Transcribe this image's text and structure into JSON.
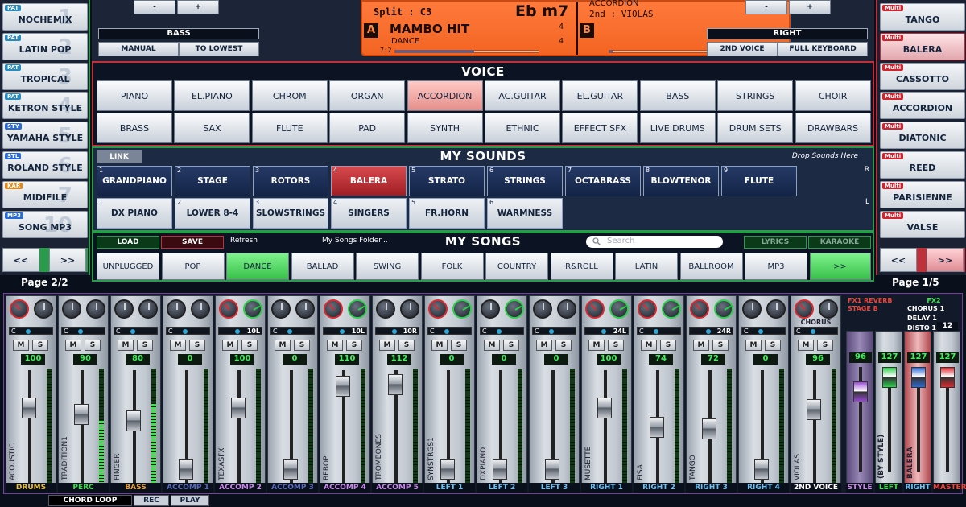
{
  "left_styles": [
    {
      "tag": "PAT",
      "tag_color": "teal",
      "label": "NOCHEMIX",
      "ghost": "1"
    },
    {
      "tag": "PAT",
      "tag_color": "teal",
      "label": "LATIN POP",
      "ghost": "2"
    },
    {
      "tag": "PAT",
      "tag_color": "teal",
      "label": "TROPICAL",
      "ghost": "3"
    },
    {
      "tag": "PAT",
      "tag_color": "teal",
      "label": "KETRON STYLE",
      "ghost": "4"
    },
    {
      "tag": "STY",
      "tag_color": "blue",
      "label": "YAMAHA STYLE",
      "ghost": "5"
    },
    {
      "tag": "STL",
      "tag_color": "blue",
      "label": "ROLAND STYLE",
      "ghost": "6"
    },
    {
      "tag": "KAR",
      "tag_color": "orange",
      "label": "MIDIFILE",
      "ghost": "7"
    },
    {
      "tag": "MP3",
      "tag_color": "blue",
      "label": "SONG MP3",
      "ghost": "10"
    }
  ],
  "right_styles": [
    {
      "tag": "Multi",
      "tag_color": "red",
      "label": "TANGO",
      "ghost": "",
      "selected": false
    },
    {
      "tag": "Multi",
      "tag_color": "red",
      "label": "BALERA",
      "ghost": "",
      "selected": true
    },
    {
      "tag": "Multi",
      "tag_color": "red",
      "label": "CASSOTTO",
      "ghost": "",
      "selected": false
    },
    {
      "tag": "Multi",
      "tag_color": "red",
      "label": "ACCORDION",
      "ghost": "",
      "selected": false
    },
    {
      "tag": "Multi",
      "tag_color": "red",
      "label": "DIATONIC",
      "ghost": "",
      "selected": false
    },
    {
      "tag": "Multi",
      "tag_color": "red",
      "label": "REED",
      "ghost": "",
      "selected": false
    },
    {
      "tag": "Multi",
      "tag_color": "red",
      "label": "PARISIENNE",
      "ghost": "",
      "selected": false
    },
    {
      "tag": "Multi",
      "tag_color": "red",
      "label": "VALSE",
      "ghost": "",
      "selected": false
    }
  ],
  "pager": {
    "prev": "<<",
    "next": ">>"
  },
  "top": {
    "minus": "-",
    "plus": "+",
    "bass_title": "BASS",
    "bass_manual": "MANUAL",
    "bass_lowest": "TO LOWEST",
    "right_title": "RIGHT",
    "right_2nd_voice": "2ND VOICE",
    "right_full_kbd": "FULL KEYBOARD"
  },
  "display": {
    "split": "Split : C3",
    "chord": "Eb m7",
    "badge_a": "A",
    "badge_b": "B",
    "style_name": "MAMBO HIT",
    "style_genre": "DANCE",
    "time_sig_top": "4",
    "time_sig_bottom": "4",
    "measure": "7:2",
    "voice1": "ACCORDION",
    "voice2": "2nd : VIOLAS",
    "progress_a": 0.55,
    "progress_b": 0.02
  },
  "voice": {
    "title": "VOICE",
    "row1": [
      "PIANO",
      "EL.PIANO",
      "CHROM",
      "ORGAN",
      "ACCORDION",
      "AC.GUITAR",
      "EL.GUITAR",
      "BASS",
      "STRINGS",
      "CHOIR"
    ],
    "row2": [
      "BRASS",
      "SAX",
      "FLUTE",
      "PAD",
      "SYNTH",
      "ETHNIC",
      "EFFECT SFX",
      "LIVE DRUMS",
      "DRUM SETS",
      "DRAWBARS"
    ],
    "selected": "ACCORDION"
  },
  "sounds": {
    "title": "MY SOUNDS",
    "link": "LINK",
    "drop_hint": "Drop Sounds Here",
    "row_r": "R",
    "row_l": "L",
    "row1": [
      {
        "num": "1",
        "label": "GRANDPIANO"
      },
      {
        "num": "2",
        "label": "STAGE"
      },
      {
        "num": "3",
        "label": "ROTORS"
      },
      {
        "num": "4",
        "label": "BALERA"
      },
      {
        "num": "5",
        "label": "STRATO"
      },
      {
        "num": "6",
        "label": "STRINGS"
      },
      {
        "num": "7",
        "label": "OCTABRASS"
      },
      {
        "num": "8",
        "label": "BLOWTENOR"
      },
      {
        "num": "9",
        "label": "FLUTE"
      }
    ],
    "row2": [
      {
        "num": "1",
        "label": "DX PIANO"
      },
      {
        "num": "2",
        "label": "LOWER 8-4"
      },
      {
        "num": "3",
        "label": "SLOWSTRINGS"
      },
      {
        "num": "4",
        "label": "SINGERS"
      },
      {
        "num": "5",
        "label": "FR.HORN"
      },
      {
        "num": "6",
        "label": "WARMNESS"
      }
    ],
    "selected": "BALERA"
  },
  "songs": {
    "title": "MY SONGS",
    "load": "LOAD",
    "save": "SAVE",
    "refresh": "Refresh",
    "folder": "My Songs Folder...",
    "search_placeholder": "Search",
    "lyrics": "LYRICS",
    "karaoke": "KARAOKE",
    "genres": [
      "UNPLUGGED",
      "POP",
      "DANCE",
      "BALLAD",
      "SWING",
      "FOLK",
      "COUNTRY",
      "R&ROLL",
      "LATIN",
      "BALLROOM",
      "MP3",
      ">>"
    ],
    "selected": "DANCE"
  },
  "pages": {
    "left": "Page 2/2",
    "right": "Page 1/5"
  },
  "mixer": {
    "channels": [
      {
        "name": "ACOUSTIC",
        "group": "DRUMS",
        "group_color": "#e8c23a",
        "vol": "100",
        "pan": "C",
        "pan_val": "",
        "k1": "red",
        "k2": "gray",
        "level": 0.0,
        "fader": 0.28,
        "top": ""
      },
      {
        "name": "TRADITION1",
        "group": "PERC",
        "group_color": "#3ce04e",
        "vol": "90",
        "pan": "C",
        "pan_val": "",
        "k1": "gray",
        "k2": "gray",
        "level": 0.55,
        "fader": 0.35,
        "top": ""
      },
      {
        "name": "FINGER",
        "group": "BASS",
        "group_color": "#e8a23a",
        "vol": "80",
        "pan": "C",
        "pan_val": "",
        "k1": "gray",
        "k2": "gray",
        "level": 0.7,
        "fader": 0.42,
        "top": ""
      },
      {
        "name": "",
        "group": "ACCOMP 1",
        "group_color": "#5a6ab8",
        "vol": "0",
        "pan": "C",
        "pan_val": "",
        "k1": "gray",
        "k2": "gray",
        "level": 0.0,
        "fader": 0.92,
        "top": ""
      },
      {
        "name": "TEXASFX",
        "group": "ACCOMP 2",
        "group_color": "#c88ae8",
        "vol": "100",
        "pan": "",
        "pan_val": "10L",
        "k1": "red",
        "k2": "green",
        "level": 0.0,
        "fader": 0.28,
        "top": ""
      },
      {
        "name": "",
        "group": "ACCOMP 3",
        "group_color": "#5a6ab8",
        "vol": "0",
        "pan": "C",
        "pan_val": "",
        "k1": "gray",
        "k2": "gray",
        "level": 0.0,
        "fader": 0.92,
        "top": ""
      },
      {
        "name": "BEBOP",
        "group": "ACCOMP 4",
        "group_color": "#c88ae8",
        "vol": "110",
        "pan": "",
        "pan_val": "10L",
        "k1": "red",
        "k2": "green",
        "level": 0.0,
        "fader": 0.06,
        "top": ""
      },
      {
        "name": "TROMBONES",
        "group": "ACCOMP 5",
        "group_color": "#c88ae8",
        "vol": "112",
        "pan": "",
        "pan_val": "10R",
        "k1": "gray",
        "k2": "gray",
        "level": 0.0,
        "fader": 0.04,
        "top": ""
      },
      {
        "name": "SYNSTRGS1",
        "group": "LEFT 1",
        "group_color": "#6ec0f0",
        "vol": "0",
        "pan": "C",
        "pan_val": "",
        "k1": "red",
        "k2": "green",
        "level": 0.0,
        "fader": 0.92,
        "top": ""
      },
      {
        "name": "DXPIANO",
        "group": "LEFT 2",
        "group_color": "#6ec0f0",
        "vol": "0",
        "pan": "C",
        "pan_val": "",
        "k1": "gray",
        "k2": "green",
        "level": 0.0,
        "fader": 0.92,
        "top": ""
      },
      {
        "name": "",
        "group": "LEFT 3",
        "group_color": "#6ec0f0",
        "vol": "0",
        "pan": "C",
        "pan_val": "",
        "k1": "gray",
        "k2": "gray",
        "level": 0.0,
        "fader": 0.92,
        "top": ""
      },
      {
        "name": "MUSETTE",
        "group": "RIGHT 1",
        "group_color": "#6ec0f0",
        "vol": "100",
        "pan": "",
        "pan_val": "24L",
        "k1": "red",
        "k2": "green",
        "level": 0.0,
        "fader": 0.28,
        "top": ""
      },
      {
        "name": "FISA",
        "group": "RIGHT 2",
        "group_color": "#6ec0f0",
        "vol": "74",
        "pan": "C",
        "pan_val": "",
        "k1": "red",
        "k2": "green",
        "level": 0.0,
        "fader": 0.48,
        "top": ""
      },
      {
        "name": "TANGO",
        "group": "RIGHT 3",
        "group_color": "#6ec0f0",
        "vol": "72",
        "pan": "",
        "pan_val": "24R",
        "k1": "red",
        "k2": "green",
        "level": 0.0,
        "fader": 0.5,
        "top": ""
      },
      {
        "name": "",
        "group": "RIGHT 4",
        "group_color": "#6ec0f0",
        "vol": "0",
        "pan": "C",
        "pan_val": "",
        "k1": "gray",
        "k2": "gray",
        "level": 0.0,
        "fader": 0.92,
        "top": ""
      },
      {
        "name": "VIOLAS",
        "group": "2ND VOICE",
        "group_color": "#ffffff",
        "vol": "96",
        "pan": "C",
        "pan_val": "",
        "k1": "red",
        "k2": "gray",
        "level": 0.0,
        "fader": 0.3,
        "top": "CHORUS"
      }
    ],
    "master": {
      "fx1": "FX1 REVERB",
      "fx1_sub": "STAGE B",
      "fx2": "FX2",
      "fx2_items": [
        "CHORUS 1",
        "DELAY 1",
        "DISTO 1"
      ],
      "style": {
        "vol": "96",
        "label": "STYLE",
        "fader": 0.15
      },
      "left": {
        "vol": "127",
        "label": "LEFT",
        "name": "(BY STYLE)",
        "fader": 0.0
      },
      "right": {
        "vol": "127",
        "label": "RIGHT",
        "name": "BALERA",
        "fader": 0.0
      },
      "master": {
        "vol": "127",
        "top": "12",
        "label": "MASTER",
        "fader": 0.0
      }
    }
  },
  "bottom": {
    "chord_loop": "CHORD LOOP",
    "rec": "REC",
    "play": "PLAY"
  }
}
